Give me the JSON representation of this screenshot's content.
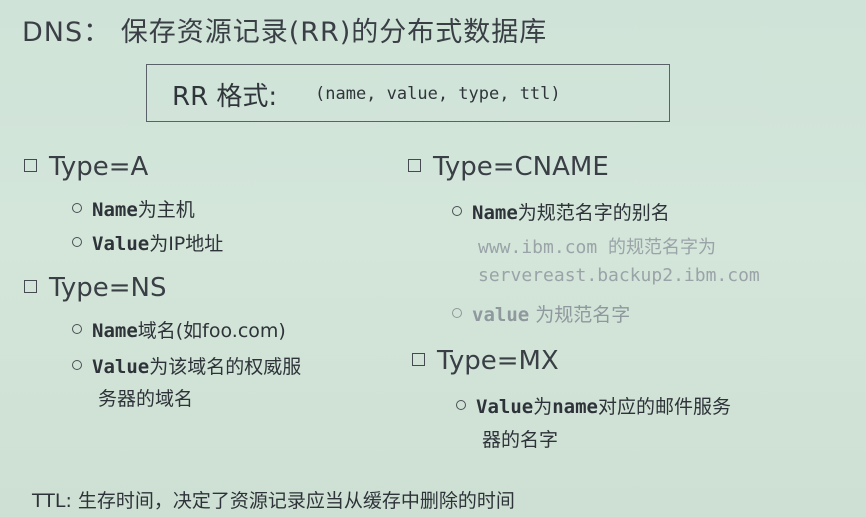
{
  "title": "DNS： 保存资源记录(RR)的分布式数据库",
  "rr_format": {
    "label": "RR 格式:",
    "value": "(name, value, type, ttl)"
  },
  "type_a": {
    "heading": "Type=A",
    "name_key": "Name",
    "name_desc": "为主机",
    "value_key": "Value",
    "value_desc": "为IP地址"
  },
  "type_ns": {
    "heading": "Type=NS",
    "name_key": "Name",
    "name_desc": "域名(如foo.com)",
    "value_key": "Value",
    "value_desc_line1": "为该域名的权威服",
    "value_desc_line2": "务器的域名"
  },
  "type_cname": {
    "heading": "Type=CNAME",
    "name_key": "Name",
    "name_desc": "为规范名字的别名",
    "example_line1": "www.ibm.com 的规范名字为",
    "example_line2": "servereast.backup2.ibm.com",
    "value_key": "value",
    "value_desc": "为规范名字"
  },
  "type_mx": {
    "heading": "Type=MX",
    "value_key": "Value",
    "value_desc_mid": "为",
    "value_name_key": "name",
    "value_desc_line1": "对应的邮件服务",
    "value_desc_line2": "器的名字"
  },
  "footer": "TTL: 生存时间，决定了资源记录应当从缓存中删除的时间"
}
